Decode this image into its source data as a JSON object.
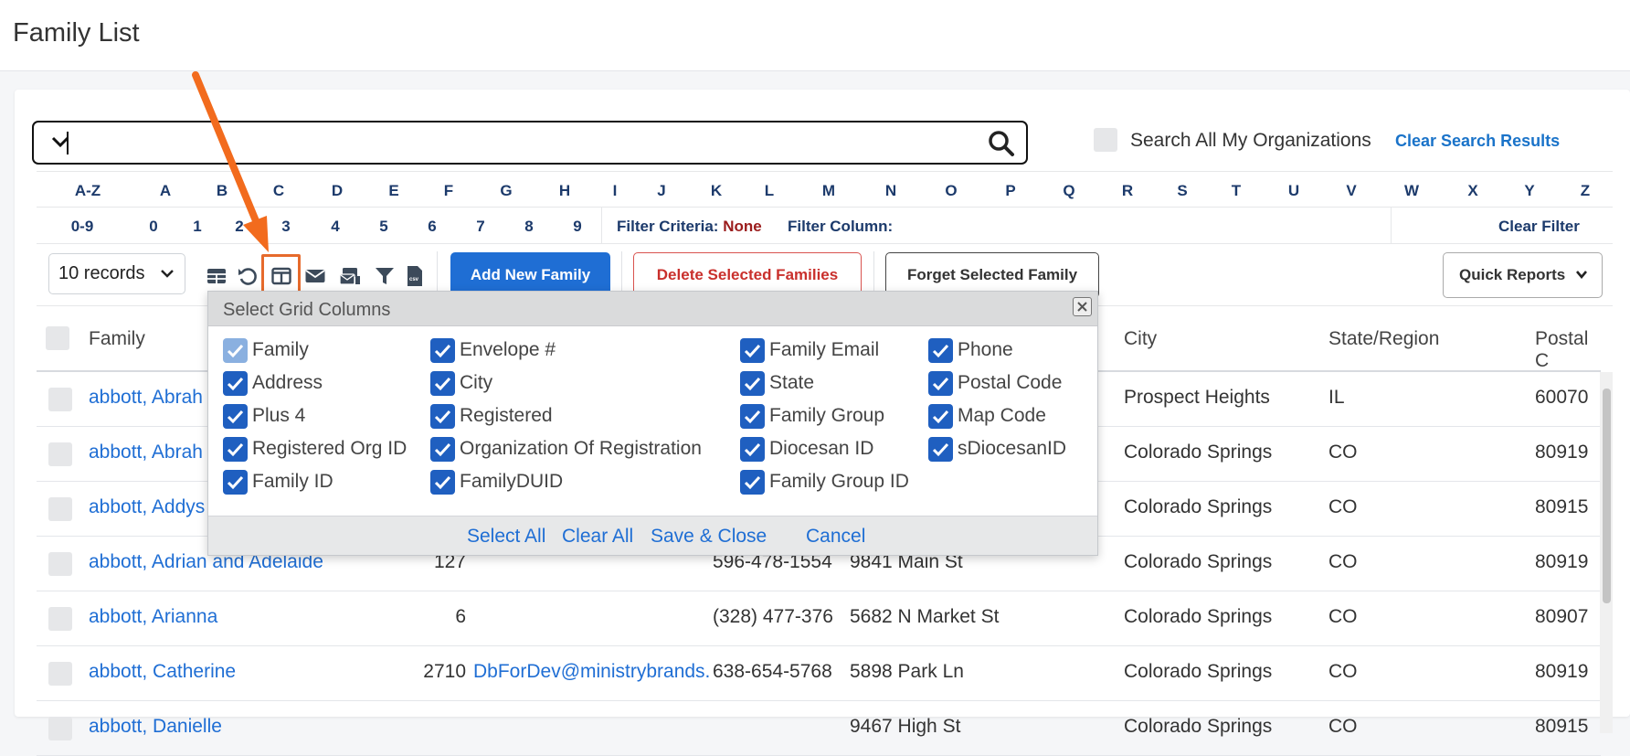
{
  "page": {
    "title": "Family List"
  },
  "search": {
    "value": "",
    "search_all_label": "Search All My Organizations",
    "clear_results_label": "Clear Search Results"
  },
  "alpha": {
    "letters": [
      "A-Z",
      "A",
      "B",
      "C",
      "D",
      "E",
      "F",
      "G",
      "H",
      "I",
      "J",
      "K",
      "L",
      "M",
      "N",
      "O",
      "P",
      "Q",
      "R",
      "S",
      "T",
      "U",
      "V",
      "W",
      "X",
      "Y",
      "Z"
    ],
    "digits": [
      "0-9",
      "0",
      "1",
      "2",
      "3",
      "4",
      "5",
      "6",
      "7",
      "8",
      "9"
    ]
  },
  "filter": {
    "criteria_label": "Filter Criteria:",
    "criteria_value": "None",
    "column_label": "Filter Column:",
    "clear_label": "Clear Filter"
  },
  "toolbar": {
    "records_select": "10 records",
    "icons": [
      "grid-icon",
      "undo-icon",
      "columns-icon",
      "email-icon",
      "mail-merge-icon",
      "filter-icon",
      "csv-icon"
    ],
    "add_label": "Add New Family",
    "delete_label": "Delete Selected Families",
    "forget_label": "Forget Selected Family",
    "quick_reports_label": "Quick Reports"
  },
  "table": {
    "headers": {
      "family": "Family",
      "city": "City",
      "state": "State/Region",
      "postal": "Postal C"
    },
    "rows": [
      {
        "family": "abbott, Abrah",
        "envelope": "",
        "email": "",
        "phone": "",
        "address": "",
        "city": "Prospect Heights",
        "state": "IL",
        "postal": "60070"
      },
      {
        "family": "abbott, Abrah",
        "envelope": "",
        "email": "",
        "phone": "",
        "address": "",
        "city": "Colorado Springs",
        "state": "CO",
        "postal": "80919"
      },
      {
        "family": "abbott, Addys",
        "envelope": "",
        "email": "",
        "phone": "",
        "address": "",
        "city": "Colorado Springs",
        "state": "CO",
        "postal": "80915"
      },
      {
        "family": "abbott, Adrian and Adelaide",
        "envelope": "127",
        "email": "",
        "phone": "596-478-1554",
        "address": "9841 Main St",
        "city": "Colorado Springs",
        "state": "CO",
        "postal": "80919"
      },
      {
        "family": "abbott, Arianna",
        "envelope": "6",
        "email": "",
        "phone": "(328) 477-376",
        "address": "5682 N Market St",
        "city": "Colorado Springs",
        "state": "CO",
        "postal": "80907"
      },
      {
        "family": "abbott, Catherine",
        "envelope": "2710",
        "email": "DbForDev@ministrybrands.",
        "phone": "638-654-5768",
        "address": "5898 Park Ln",
        "city": "Colorado Springs",
        "state": "CO",
        "postal": "80919"
      },
      {
        "family": "abbott, Danielle",
        "envelope": "",
        "email": "",
        "phone": "",
        "address": "9467 High St",
        "city": "Colorado Springs",
        "state": "CO",
        "postal": "80915"
      }
    ]
  },
  "modal": {
    "title": "Select Grid Columns",
    "options": [
      {
        "label": "Family",
        "checked": true,
        "disabled": true
      },
      {
        "label": "Envelope #",
        "checked": true
      },
      {
        "label": "Family Email",
        "checked": true
      },
      {
        "label": "Phone",
        "checked": true
      },
      {
        "label": "Address",
        "checked": true
      },
      {
        "label": "City",
        "checked": true
      },
      {
        "label": "State",
        "checked": true
      },
      {
        "label": "Postal Code",
        "checked": true
      },
      {
        "label": "Plus 4",
        "checked": true
      },
      {
        "label": "Registered",
        "checked": true
      },
      {
        "label": "Family Group",
        "checked": true
      },
      {
        "label": "Map Code",
        "checked": true
      },
      {
        "label": "Registered Org ID",
        "checked": true
      },
      {
        "label": "Organization Of Registration",
        "checked": true
      },
      {
        "label": "Diocesan ID",
        "checked": true
      },
      {
        "label": "sDiocesanID",
        "checked": true
      },
      {
        "label": "Family ID",
        "checked": true
      },
      {
        "label": "FamilyDUID",
        "checked": true
      },
      {
        "label": "Family Group ID",
        "checked": true
      }
    ],
    "select_all": "Select All",
    "clear_all": "Clear All",
    "save_close": "Save & Close",
    "cancel": "Cancel"
  },
  "colors": {
    "accent": "#1f6ed4",
    "danger": "#c9302c",
    "annotation": "#f26b1d",
    "checkbox": "#1f5fc0"
  }
}
